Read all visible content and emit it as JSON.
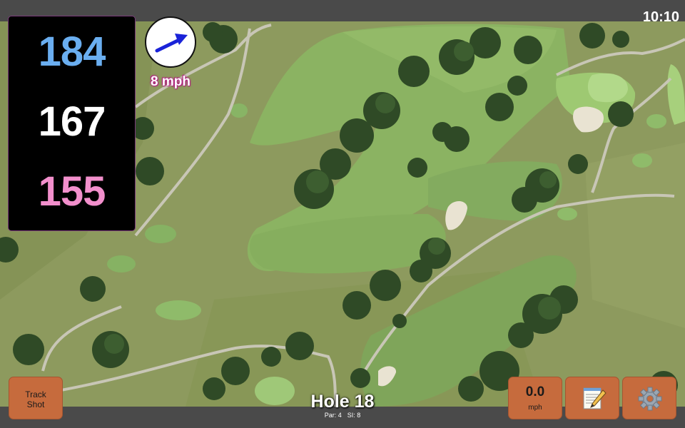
{
  "status_bar": {
    "time": "10:10"
  },
  "yardages": {
    "back": "184",
    "center": "167",
    "front": "155"
  },
  "wind": {
    "speed_label": "8 mph",
    "direction": "east-northeast",
    "icon": "arrow-icon"
  },
  "hole": {
    "title": "Hole 18",
    "par": "Par: 4",
    "stroke_index": "SI: 8"
  },
  "buttons": {
    "track_shot_line1": "Track",
    "track_shot_line2": "Shot",
    "speed_value": "0.0",
    "speed_unit": "mph",
    "notes_icon": "notepad-icon",
    "settings_icon": "gear-icon"
  },
  "colors": {
    "back_yardage": "#6aaef0",
    "center_yardage": "#ffffff",
    "front_yardage": "#f28fcc",
    "button_fill": "#c66b3d",
    "wind_text_outline": "#b0207f"
  }
}
